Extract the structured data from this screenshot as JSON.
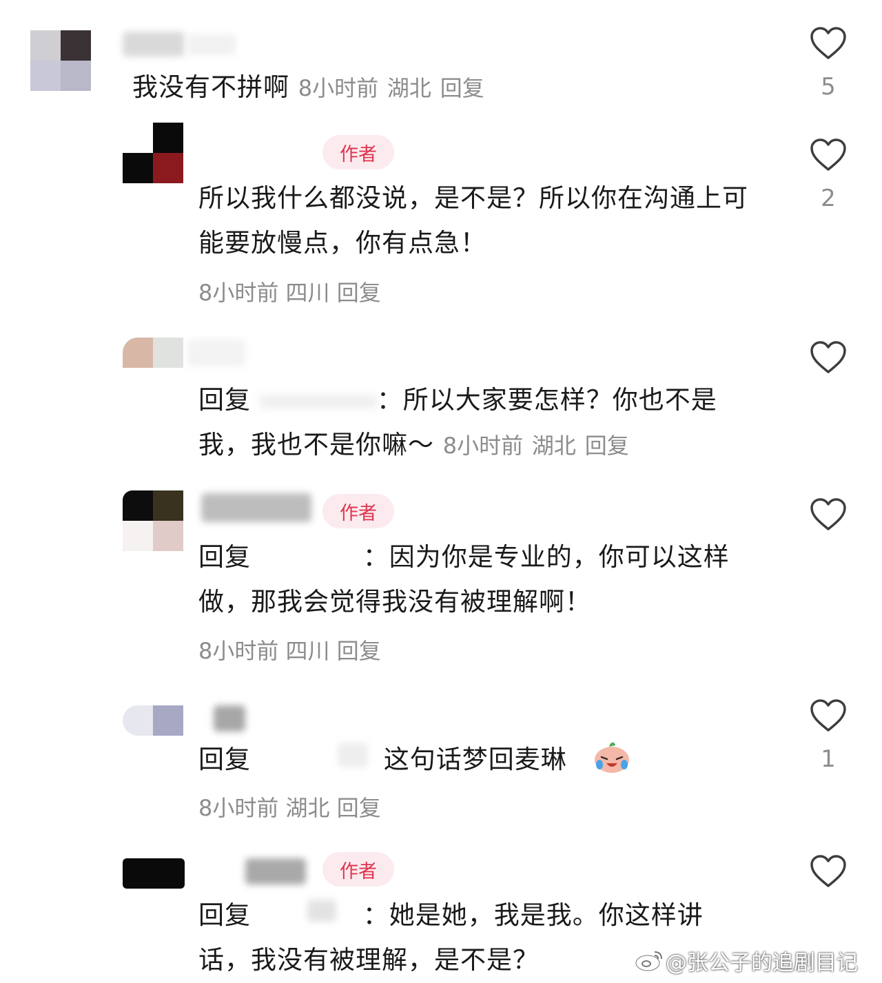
{
  "comments": [
    {
      "text": "我没有不拼啊",
      "time": "8小时前",
      "location": "湖北",
      "reply_label": "回复",
      "likes": "5"
    },
    {
      "author_badge": "作者",
      "text": "所以我什么都没说，是不是？所以你在沟通上可能要放慢点，你有点急！",
      "time": "8小时前",
      "location": "四川",
      "reply_label": "回复",
      "likes": "2"
    },
    {
      "reply_prefix": "回复",
      "colon": "：",
      "text": "所以大家要怎样？你也不是我，我也不是你嘛～",
      "time": "8小时前",
      "location": "湖北",
      "reply_label": "回复"
    },
    {
      "author_badge": "作者",
      "reply_prefix": "回复",
      "colon": "：",
      "text": "因为你是专业的，你可以这样做，那我会觉得我没有被理解啊！",
      "time": "8小时前",
      "location": "四川",
      "reply_label": "回复"
    },
    {
      "reply_prefix": "回复",
      "text": "这句话梦回麦琳",
      "emoji": "crying-laughing-emoji",
      "time": "8小时前",
      "location": "湖北",
      "reply_label": "回复",
      "likes": "1"
    },
    {
      "author_badge": "作者",
      "reply_prefix": "回复",
      "colon": "：",
      "text": "她是她，我是我。你这样讲话，我没有被理解，是不是？"
    }
  ],
  "watermark": "@张公子的追剧目记",
  "icons": {
    "like": "heart-outline-icon",
    "watermark": "weibo-icon"
  },
  "colors": {
    "badge_bg": "#fcebee",
    "badge_text": "#e0344f",
    "meta": "#8c8c8c",
    "text": "#1a1a1a"
  }
}
